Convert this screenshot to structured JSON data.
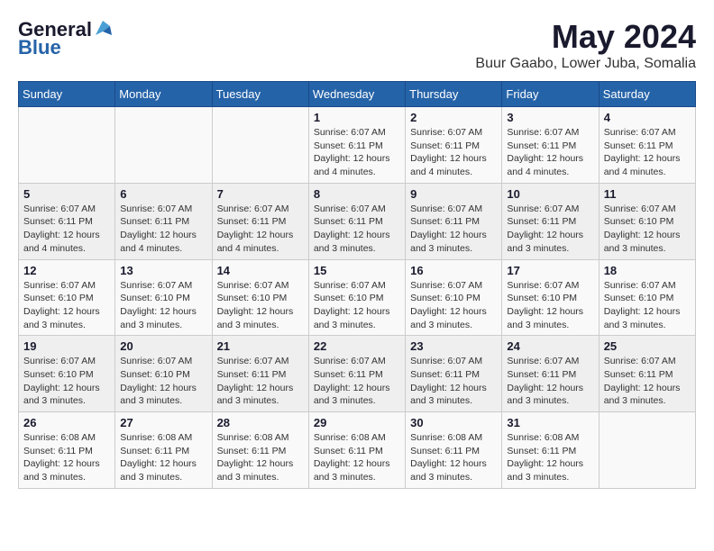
{
  "app": {
    "logo_general": "General",
    "logo_blue": "Blue",
    "month_title": "May 2024",
    "subtitle": "Buur Gaabo, Lower Juba, Somalia"
  },
  "calendar": {
    "headers": [
      "Sunday",
      "Monday",
      "Tuesday",
      "Wednesday",
      "Thursday",
      "Friday",
      "Saturday"
    ],
    "weeks": [
      [
        {
          "day": "",
          "info": ""
        },
        {
          "day": "",
          "info": ""
        },
        {
          "day": "",
          "info": ""
        },
        {
          "day": "1",
          "info": "Sunrise: 6:07 AM\nSunset: 6:11 PM\nDaylight: 12 hours\nand 4 minutes."
        },
        {
          "day": "2",
          "info": "Sunrise: 6:07 AM\nSunset: 6:11 PM\nDaylight: 12 hours\nand 4 minutes."
        },
        {
          "day": "3",
          "info": "Sunrise: 6:07 AM\nSunset: 6:11 PM\nDaylight: 12 hours\nand 4 minutes."
        },
        {
          "day": "4",
          "info": "Sunrise: 6:07 AM\nSunset: 6:11 PM\nDaylight: 12 hours\nand 4 minutes."
        }
      ],
      [
        {
          "day": "5",
          "info": "Sunrise: 6:07 AM\nSunset: 6:11 PM\nDaylight: 12 hours\nand 4 minutes."
        },
        {
          "day": "6",
          "info": "Sunrise: 6:07 AM\nSunset: 6:11 PM\nDaylight: 12 hours\nand 4 minutes."
        },
        {
          "day": "7",
          "info": "Sunrise: 6:07 AM\nSunset: 6:11 PM\nDaylight: 12 hours\nand 4 minutes."
        },
        {
          "day": "8",
          "info": "Sunrise: 6:07 AM\nSunset: 6:11 PM\nDaylight: 12 hours\nand 3 minutes."
        },
        {
          "day": "9",
          "info": "Sunrise: 6:07 AM\nSunset: 6:11 PM\nDaylight: 12 hours\nand 3 minutes."
        },
        {
          "day": "10",
          "info": "Sunrise: 6:07 AM\nSunset: 6:11 PM\nDaylight: 12 hours\nand 3 minutes."
        },
        {
          "day": "11",
          "info": "Sunrise: 6:07 AM\nSunset: 6:10 PM\nDaylight: 12 hours\nand 3 minutes."
        }
      ],
      [
        {
          "day": "12",
          "info": "Sunrise: 6:07 AM\nSunset: 6:10 PM\nDaylight: 12 hours\nand 3 minutes."
        },
        {
          "day": "13",
          "info": "Sunrise: 6:07 AM\nSunset: 6:10 PM\nDaylight: 12 hours\nand 3 minutes."
        },
        {
          "day": "14",
          "info": "Sunrise: 6:07 AM\nSunset: 6:10 PM\nDaylight: 12 hours\nand 3 minutes."
        },
        {
          "day": "15",
          "info": "Sunrise: 6:07 AM\nSunset: 6:10 PM\nDaylight: 12 hours\nand 3 minutes."
        },
        {
          "day": "16",
          "info": "Sunrise: 6:07 AM\nSunset: 6:10 PM\nDaylight: 12 hours\nand 3 minutes."
        },
        {
          "day": "17",
          "info": "Sunrise: 6:07 AM\nSunset: 6:10 PM\nDaylight: 12 hours\nand 3 minutes."
        },
        {
          "day": "18",
          "info": "Sunrise: 6:07 AM\nSunset: 6:10 PM\nDaylight: 12 hours\nand 3 minutes."
        }
      ],
      [
        {
          "day": "19",
          "info": "Sunrise: 6:07 AM\nSunset: 6:10 PM\nDaylight: 12 hours\nand 3 minutes."
        },
        {
          "day": "20",
          "info": "Sunrise: 6:07 AM\nSunset: 6:10 PM\nDaylight: 12 hours\nand 3 minutes."
        },
        {
          "day": "21",
          "info": "Sunrise: 6:07 AM\nSunset: 6:11 PM\nDaylight: 12 hours\nand 3 minutes."
        },
        {
          "day": "22",
          "info": "Sunrise: 6:07 AM\nSunset: 6:11 PM\nDaylight: 12 hours\nand 3 minutes."
        },
        {
          "day": "23",
          "info": "Sunrise: 6:07 AM\nSunset: 6:11 PM\nDaylight: 12 hours\nand 3 minutes."
        },
        {
          "day": "24",
          "info": "Sunrise: 6:07 AM\nSunset: 6:11 PM\nDaylight: 12 hours\nand 3 minutes."
        },
        {
          "day": "25",
          "info": "Sunrise: 6:07 AM\nSunset: 6:11 PM\nDaylight: 12 hours\nand 3 minutes."
        }
      ],
      [
        {
          "day": "26",
          "info": "Sunrise: 6:08 AM\nSunset: 6:11 PM\nDaylight: 12 hours\nand 3 minutes."
        },
        {
          "day": "27",
          "info": "Sunrise: 6:08 AM\nSunset: 6:11 PM\nDaylight: 12 hours\nand 3 minutes."
        },
        {
          "day": "28",
          "info": "Sunrise: 6:08 AM\nSunset: 6:11 PM\nDaylight: 12 hours\nand 3 minutes."
        },
        {
          "day": "29",
          "info": "Sunrise: 6:08 AM\nSunset: 6:11 PM\nDaylight: 12 hours\nand 3 minutes."
        },
        {
          "day": "30",
          "info": "Sunrise: 6:08 AM\nSunset: 6:11 PM\nDaylight: 12 hours\nand 3 minutes."
        },
        {
          "day": "31",
          "info": "Sunrise: 6:08 AM\nSunset: 6:11 PM\nDaylight: 12 hours\nand 3 minutes."
        },
        {
          "day": "",
          "info": ""
        }
      ]
    ]
  }
}
